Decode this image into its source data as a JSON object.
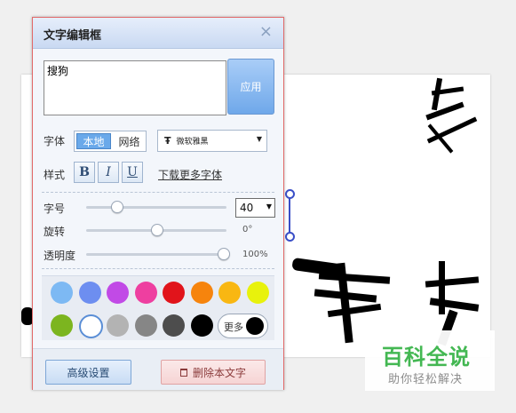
{
  "panel": {
    "title": "文字编辑框",
    "close_icon": "×",
    "text_value": "搜狗",
    "apply_label": "应用",
    "font": {
      "label": "字体",
      "source_options": [
        "本地",
        "网络"
      ],
      "source_selected": "本地",
      "font_icon": "Ŧ",
      "font_name": "微软雅黑",
      "arrow": "▼"
    },
    "style": {
      "label": "样式",
      "bold": "B",
      "italic": "I",
      "underline": "U",
      "download_link": "下载更多字体"
    },
    "size": {
      "label": "字号",
      "value": "40",
      "arrow": "▼",
      "slider_level": 0.2
    },
    "rotate": {
      "label": "旋转",
      "value": "0°",
      "slider_level": 0.5
    },
    "opacity": {
      "label": "透明度",
      "value": "100%",
      "slider_level": 1.0
    },
    "colors": {
      "row1": [
        "#7db9f3",
        "#6d8ef0",
        "#c14ae6",
        "#ee3fa0",
        "#e1141b",
        "#f6840d",
        "#f9b712",
        "#e8f20c"
      ],
      "row2": [
        "#7cb51f",
        "#ffffff",
        "#b3b3b3",
        "#868686",
        "#4d4d4d",
        "#000000"
      ],
      "selected": "#ffffff",
      "more_label": "更多",
      "more_color": "#000000"
    },
    "advanced_label": "高级设置",
    "delete_label": "删除本文字"
  },
  "watermark": {
    "title": "百科全说",
    "subtitle": "助你轻松解决"
  }
}
